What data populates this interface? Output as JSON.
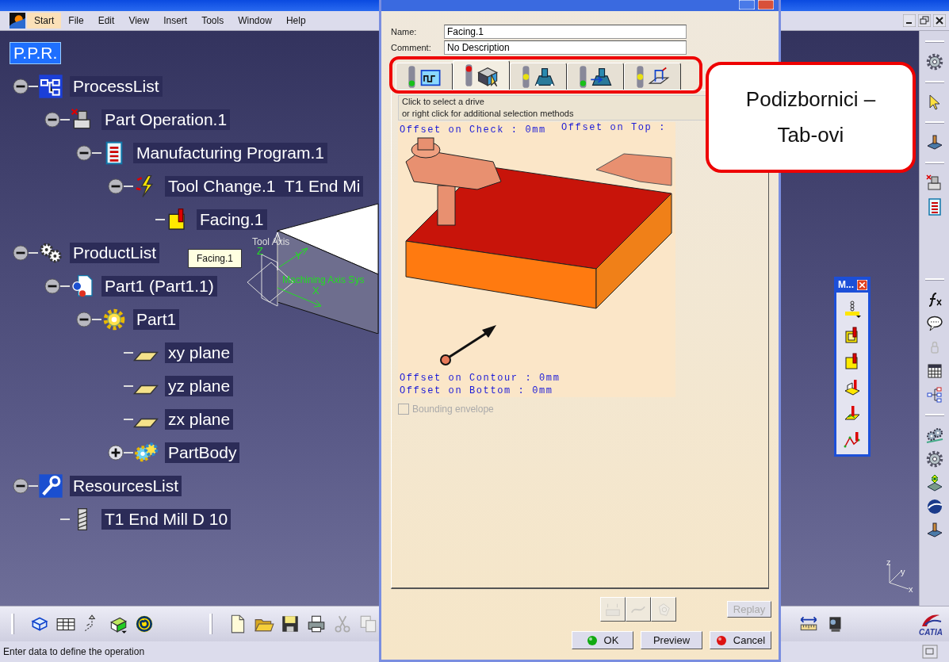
{
  "menu_bar": {
    "items": [
      {
        "label": "Start",
        "selected": true
      },
      {
        "label": "File",
        "selected": false
      },
      {
        "label": "Edit",
        "selected": false
      },
      {
        "label": "View",
        "selected": false
      },
      {
        "label": "Insert",
        "selected": false
      },
      {
        "label": "Tools",
        "selected": false
      },
      {
        "label": "Window",
        "selected": false
      },
      {
        "label": "Help",
        "selected": false
      }
    ]
  },
  "tree": {
    "items": [
      {
        "label": "P.P.R.",
        "kind": "root",
        "selected": true,
        "children": [
          {
            "label": "ProcessList",
            "kind": "process-list",
            "selected": false,
            "expanded": true,
            "children": [
              {
                "label": "Part Operation.1",
                "kind": "part-operation",
                "selected": false,
                "expanded": true,
                "children": [
                  {
                    "label": "Manufacturing Program.1",
                    "kind": "program",
                    "selected": false,
                    "expanded": true,
                    "children": [
                      {
                        "label": "Tool Change.1  T1 End Mi",
                        "kind": "tool-change",
                        "selected": false,
                        "expanded": true,
                        "children": [
                          {
                            "label": "Facing.1",
                            "kind": "facing",
                            "selected": false
                          }
                        ]
                      }
                    ]
                  }
                ]
              }
            ]
          },
          {
            "label": "ProductList",
            "kind": "product-list",
            "selected": false,
            "expanded": true,
            "children": [
              {
                "label": "Part1 (Part1.1)",
                "kind": "product",
                "selected": false,
                "expanded": true,
                "children": [
                  {
                    "label": "Part1",
                    "kind": "part",
                    "selected": false,
                    "expanded": true,
                    "children": [
                      {
                        "label": "xy plane",
                        "kind": "plane",
                        "selected": false
                      },
                      {
                        "label": "yz plane",
                        "kind": "plane",
                        "selected": false
                      },
                      {
                        "label": "zx plane",
                        "kind": "plane",
                        "selected": false
                      },
                      {
                        "label": "PartBody",
                        "kind": "body",
                        "selected": false,
                        "expanded": false
                      }
                    ]
                  }
                ]
              }
            ]
          },
          {
            "label": "ResourcesList",
            "kind": "resources-list",
            "selected": false,
            "expanded": true,
            "children": [
              {
                "label": "T1 End Mill D 10",
                "kind": "tool",
                "selected": false
              }
            ]
          }
        ]
      }
    ]
  },
  "viewport": {
    "tool_axis_label": "Tool Axis",
    "axis_labels": [
      "Z",
      "Y",
      "X"
    ],
    "axis_system_label": "Machining Axis Sys",
    "tooltip": "Facing.1",
    "compass_labels": [
      "z",
      "y",
      "x"
    ]
  },
  "dialog": {
    "name_label": "Name:",
    "name_value": "Facing.1",
    "comment_label": "Comment:",
    "comment_value": "No Description",
    "tabs": [
      {
        "selected": false,
        "color": "#18c018"
      },
      {
        "selected": true,
        "color": "#e01010"
      },
      {
        "selected": false,
        "color": "#e8e010"
      },
      {
        "selected": false,
        "color": "#18c018"
      },
      {
        "selected": false,
        "color": "#e8e010"
      }
    ],
    "hint_lines": [
      "Click to select a drive",
      "or right click for additional selection methods"
    ],
    "diagram_labels": {
      "check": "Offset on Check : 0mm",
      "top": "Offset on Top :",
      "contour": "Offset on Contour : 0mm",
      "bottom": "Offset on Bottom : 0mm"
    },
    "bounding_envelope": {
      "label": "Bounding envelope",
      "checked": false,
      "disabled": true
    },
    "tool_buttons": [
      {
        "disabled": true
      },
      {
        "disabled": true
      },
      {
        "disabled": true
      }
    ],
    "replay": {
      "label": "Replay",
      "disabled": true
    },
    "buttons": [
      {
        "label": "OK",
        "kind": "ok"
      },
      {
        "label": "Preview",
        "kind": "preview"
      },
      {
        "label": "Cancel",
        "kind": "cancel"
      }
    ]
  },
  "callout": {
    "text": "Podizbornici – Tab-ovi"
  },
  "floating_toolbar": {
    "title": "M..."
  },
  "logo": {
    "text": "CATIA"
  },
  "status_bar": {
    "text": "Enter data to define the operation"
  }
}
